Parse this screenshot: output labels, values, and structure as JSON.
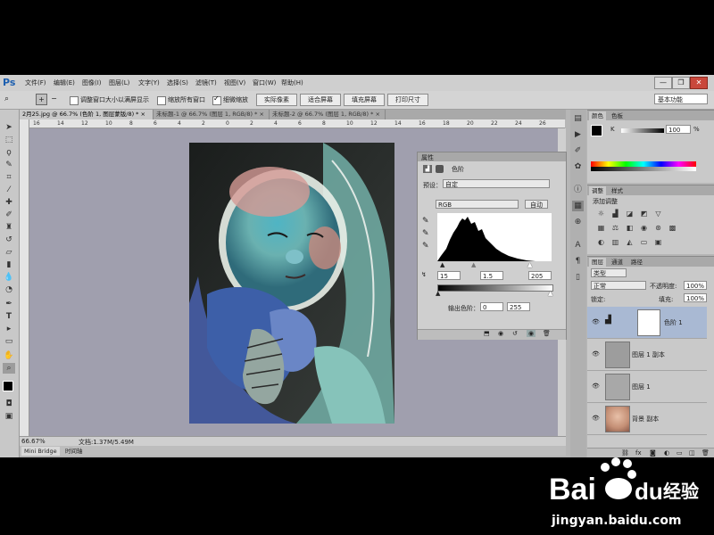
{
  "app": {
    "logo": "Ps"
  },
  "menu": [
    "文件(F)",
    "编辑(E)",
    "图像(I)",
    "图层(L)",
    "文字(Y)",
    "选择(S)",
    "滤镜(T)",
    "视图(V)",
    "窗口(W)",
    "帮助(H)"
  ],
  "window_controls": {
    "minimize": "—",
    "restore": "❐",
    "close": "✕"
  },
  "options": {
    "zoom_glyph": "🔍",
    "resize_windows": "调整窗口大小以满屏显示",
    "zoom_all": "缩放所有窗口",
    "scrubby_zoom": "细微缩放",
    "actual_pixels": "实际像素",
    "fit_screen": "适合屏幕",
    "fill_screen": "填充屏幕",
    "print_size": "打印尺寸",
    "workspace": "基本功能"
  },
  "doc_tabs": [
    "2月25.jpg @ 66.7% (色阶 1, 图层蒙版/8) * ×",
    "未标题-1 @ 66.7% (图层 1, RGB/8) * ×",
    "未标题-2 @ 66.7% (图层 1, RGB/8) * ×"
  ],
  "rulers": {
    "marks": [
      "16",
      "14",
      "12",
      "10",
      "8",
      "6",
      "4",
      "2",
      "0",
      "2",
      "4",
      "6",
      "8",
      "10",
      "12",
      "14",
      "16",
      "18",
      "20",
      "22",
      "24",
      "26"
    ]
  },
  "status": {
    "zoom": "66.67%",
    "doc_info": "文档:1.37M/5.49M"
  },
  "bottom_tabs": [
    "Mini Bridge",
    "时间轴"
  ],
  "properties": {
    "tab": "属性",
    "title": "色阶",
    "preset_label": "预设：",
    "preset_value": "自定",
    "channel": "RGB",
    "auto_btn": "自动",
    "input_values": [
      "15",
      "1.5",
      "205"
    ],
    "output_label": "输出色阶：",
    "output_values": [
      "0",
      "255"
    ]
  },
  "color_panel": {
    "tabs": [
      "颜色",
      "色板"
    ],
    "channel": "K",
    "value": "100",
    "pct": "%"
  },
  "adjust_panel": {
    "tabs": [
      "调整",
      "样式"
    ],
    "title": "添加调整"
  },
  "layers_panel": {
    "tabs": [
      "图层",
      "通道",
      "路径"
    ],
    "kind_filter": "类型",
    "blend_mode": "正常",
    "opacity_label": "不透明度:",
    "opacity": "100%",
    "lock_label": "锁定:",
    "fill_label": "填充:",
    "fill": "100%",
    "layers": [
      "色阶 1",
      "图层 1 副本",
      "图层 1",
      "背景 副本"
    ]
  },
  "watermark": {
    "brand": "Bai",
    "brand2": "du",
    "site_name": "经验",
    "url": "jingyan.baidu.com"
  },
  "colors": {
    "accent": "#2b6cc4",
    "canvas": "#a09fae",
    "selection": "#a9b9d3"
  }
}
